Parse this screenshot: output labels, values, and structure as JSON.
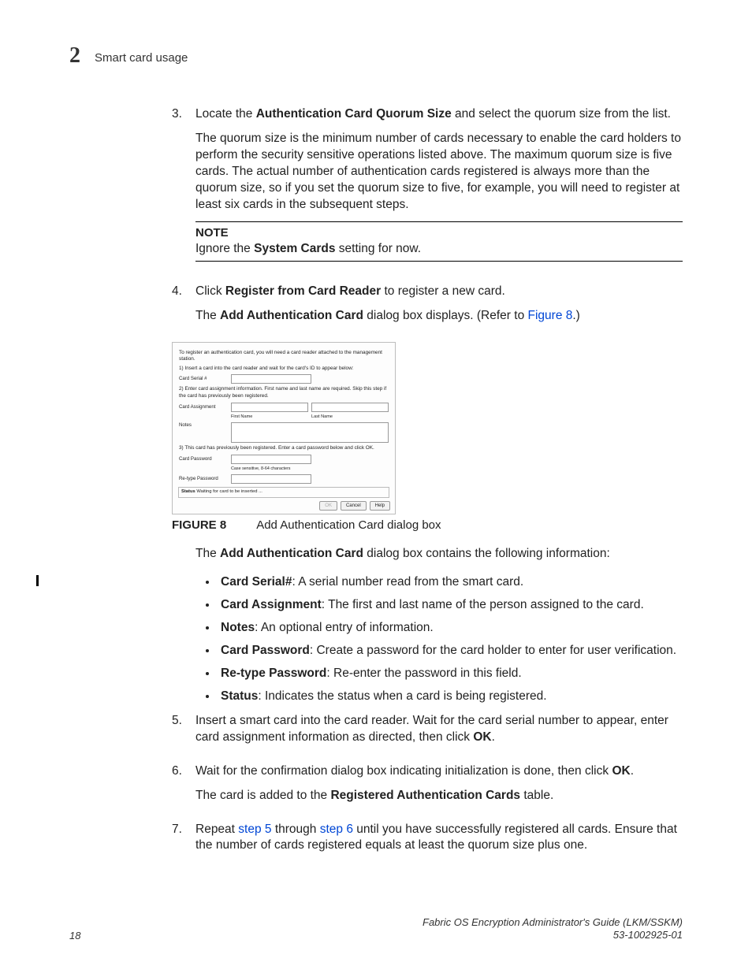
{
  "header": {
    "chapter_number": "2",
    "chapter_title": "Smart card usage"
  },
  "steps": {
    "s3": {
      "num": "3.",
      "line1a": "Locate the ",
      "line1b": "Authentication Card Quorum Size",
      "line1c": " and select the quorum size from the list.",
      "para2": "The quorum size is the minimum number of cards necessary to enable the card holders to perform the security sensitive operations listed above. The maximum quorum size is five cards. The actual number of authentication cards registered is always more than the quorum size, so if you set the quorum size to five, for example, you will need to register at least six cards in the subsequent steps.",
      "note_label": "NOTE",
      "note_a": "Ignore the ",
      "note_b": "System Cards",
      "note_c": " setting for now."
    },
    "s4": {
      "num": "4.",
      "line1a": "Click ",
      "line1b": "Register from Card Reader",
      "line1c": " to register a new card.",
      "para2a": "The ",
      "para2b": "Add Authentication Card",
      "para2c": " dialog box displays. (Refer to ",
      "para2d": "Figure 8",
      "para2e": ".)"
    },
    "dialog": {
      "intro": "To register an authentication card, you will need a card reader attached to the management station.",
      "t1": "1) Insert a card into the card reader and wait for the card's ID to appear below:",
      "serial": "Card Serial #",
      "t2": "2) Enter card assignment information. First name and last name are required. Skip this step if the card has previously been registered.",
      "assign": "Card Assignment",
      "first": "First Name",
      "last": "Last Name",
      "notes": "Notes",
      "t3": "3) This card has previously been registered. Enter a card password below and click OK.",
      "pw": "Card Password",
      "hint": "Case sensitive, 8-64 characters",
      "rpw": "Re-type Password",
      "status_l": "Status",
      "status_v": "Waiting for card to be inserted ...",
      "btn_ok": "OK",
      "btn_cancel": "Cancel",
      "btn_help": "Help"
    },
    "fig": {
      "lab": "FIGURE 8",
      "cap": "Add Authentication Card dialog box"
    },
    "after": {
      "p1a": "The ",
      "p1b": "Add Authentication Card",
      "p1c": " dialog box contains the following information:",
      "b1a": "Card Serial#",
      "b1b": ": A serial number read from the smart card.",
      "b2a": "Card Assignment",
      "b2b": ": The first and last name of the person assigned to the card.",
      "b3a": "Notes",
      "b3b": ": An optional entry of information.",
      "b4a": "Card Password",
      "b4b": ": Create a password for the card holder to enter for user verification.",
      "b5a": "Re-type Password",
      "b5b": ": Re-enter the password in this field.",
      "b6a": "Status",
      "b6b": ": Indicates the status when a card is being registered."
    },
    "s5": {
      "num": "5.",
      "a": "Insert a smart card into the card reader. Wait for the card serial number to appear, enter card assignment information as directed, then click ",
      "b": "OK",
      "c": "."
    },
    "s6": {
      "num": "6.",
      "a": "Wait for the confirmation dialog box indicating initialization is done, then click ",
      "b": "OK",
      "c": ".",
      "p2a": "The card is added to the ",
      "p2b": "Registered Authentication Cards",
      "p2c": " table."
    },
    "s7": {
      "num": "7.",
      "a": "Repeat ",
      "b": "step 5",
      "c": " through ",
      "d": "step 6",
      "e": " until you have successfully registered all cards. Ensure that the number of cards registered equals at least the quorum size plus one."
    }
  },
  "footer": {
    "page": "18",
    "title": "Fabric OS Encryption Administrator's Guide  (LKM/SSKM)",
    "doc": "53-1002925-01"
  }
}
